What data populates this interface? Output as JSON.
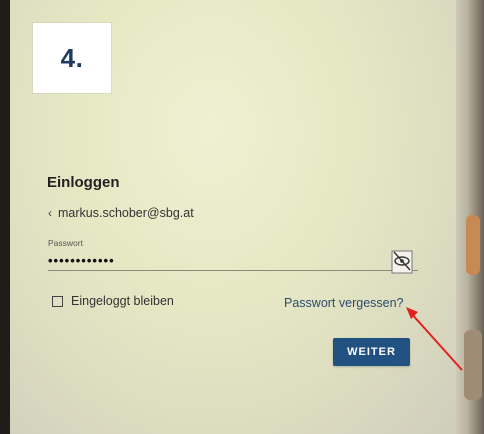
{
  "step_badge": {
    "label": "4."
  },
  "login": {
    "title": "Einloggen",
    "back_icon": "chevron-left-icon",
    "account_email": "markus.schober@sbg.at",
    "password_label": "Passwort",
    "password_value": "••••••••••••",
    "toggle_visibility_icon": "eye-slash-icon",
    "stay_logged_in_label": "Eingeloggt bleiben",
    "stay_logged_in_checked": false,
    "forgot_password_label": "Passwort vergessen?",
    "continue_button_label": "WEITER"
  },
  "colors": {
    "primary": "#205181",
    "link": "#2f4c6c",
    "badge_text": "#1f3a5f",
    "annotation_arrow": "#e3201b"
  }
}
